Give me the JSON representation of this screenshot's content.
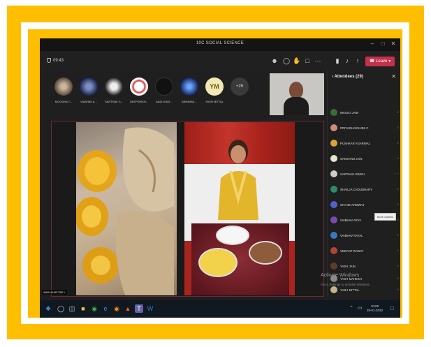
{
  "window": {
    "title": "10C SOCIAL SCIENCE"
  },
  "toolbar": {
    "timer": "09:43",
    "leave_label": "Leave"
  },
  "avatars": [
    {
      "name": "MOODHA T..."
    },
    {
      "name": "VAIBHAV A..."
    },
    {
      "name": "SARTHAK S..."
    },
    {
      "name": "DEEPSHIKH..."
    },
    {
      "name": "AADI KHAT..."
    },
    {
      "name": "ABHIMAN..."
    },
    {
      "name": "YASH MITTAL",
      "initials": "YM"
    },
    {
      "name": "",
      "initials": "+25"
    }
  ],
  "stage": {
    "speaker_label": "AADI KHATTAR"
  },
  "panel": {
    "title": "Attendees (29)",
    "attendees": [
      "NIKUNJ JAIN",
      "PRIYADHARSHINI C",
      "PUSHKAR AGARWAL",
      "SAKSHAM JAIN",
      "SARTHAK SINGH",
      "SHAILJA CHOUDHARY",
      "SIYA BHARDWAJ",
      "VAIBHAV ARYA",
      "VAIBHAV NAYAL",
      "VEDANT RAWAT",
      "YASH JAIN",
      "YASH MAHESH",
      "YASH MITTAL"
    ],
    "tooltip": "More options"
  },
  "watermark": {
    "line1": "Activate Windows",
    "line2": "Go to Settings to activate Windows."
  },
  "taskbar": {
    "time": "10:05",
    "date": "28-01-2022"
  },
  "colors": {
    "border": "#ffbe00",
    "leave": "#c4314b",
    "accent": "#6264a7"
  }
}
